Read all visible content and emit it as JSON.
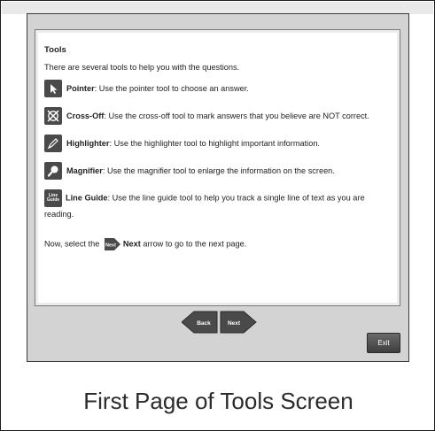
{
  "tools_panel": {
    "heading": "Tools",
    "intro": "There are several tools to help you with the questions.",
    "items": [
      {
        "name": "Pointer",
        "desc": ": Use the pointer tool to choose an answer.",
        "icon": "pointer-icon"
      },
      {
        "name": "Cross-Off",
        "desc": ": Use the cross-off tool to mark answers that you believe are NOT correct.",
        "icon": "cross-off-icon"
      },
      {
        "name": "Highlighter",
        "desc": ": Use the highlighter tool to highlight important information.",
        "icon": "highlighter-icon"
      },
      {
        "name": "Magnifier",
        "desc": ": Use the magnifier tool to enlarge the information on the screen.",
        "icon": "magnifier-icon"
      },
      {
        "name": "Line Guide",
        "desc": ": Use the line guide tool to help you track a single line of text as you are reading.",
        "icon": "line-guide-icon",
        "icon_text_1": "Line",
        "icon_text_2": "Guide"
      }
    ],
    "final_prefix": "Now, select the ",
    "final_inline_label": "Next",
    "final_bold": "Next",
    "final_suffix": " arrow to go to the next page."
  },
  "navigation": {
    "back_label": "Back",
    "next_label": "Next"
  },
  "exit_label": "Exit",
  "caption": "First Page of Tools Screen",
  "colors": {
    "frame_bg": "#d3d3d3",
    "button_dark": "#4a4a4a",
    "content_bg": "#ffffff"
  }
}
